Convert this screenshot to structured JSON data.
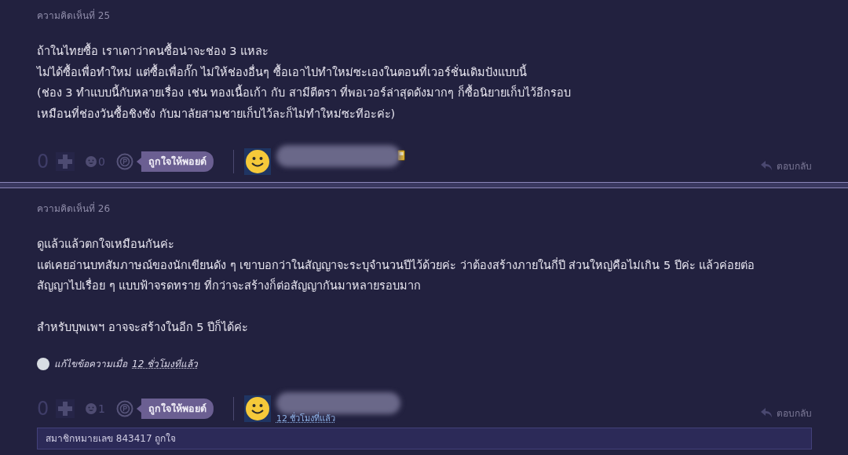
{
  "comments": [
    {
      "header": "ความคิดเห็นที่ 25",
      "body": [
        "ถ้าในไทยซื้อ เราเดาว่าคนซื้อน่าจะช่อง 3 แหละ",
        "ไม่ได้ซื้อเพื่อทำใหม่ แต่ซื้อเพื่อกั๊ก ไม่ให้ช่องอื่นๆ ซื้อเอาไปทำใหม่ซะเองในตอนที่เวอร์ชั่นเดิมปังแบบนี้",
        "(ช่อง 3 ทำแบบนี้กับหลายเรื่อง เช่น ทองเนื้อเก้า กับ สามีตีตรา ที่พอเวอร์ล่าสุดดังมากๆ ก็ซื้อนิยายเก็บไว้อีกรอบ",
        "เหมือนที่ช่องวันซื้อชิงชัง กับมาลัยสามชายเก็บไว้ละก็ไม่ทำใหม่ซะทีอะค่ะ)"
      ],
      "votes": "0",
      "emoji_count": "0",
      "point_button": "ถูกใจให้พอยด์",
      "badge": true,
      "reply": "ตอบกลับ"
    },
    {
      "header": "ความคิดเห็นที่ 26",
      "body": [
        "ดูแล้วแล้วตกใจเหมือนกันค่ะ",
        "แต่เคยอ่านบทสัมภาษณ์ของนักเขียนดัง ๆ เขาบอกว่าในสัญญาจะระบุจำนวนปีไว้ด้วยค่ะ  ว่าต้องสร้างภายในกี่ปี ส่วนใหญ่คือไม่เกิน 5 ปีค่ะ แล้วค่อยต่อ",
        "สัญญาไปเรื่อย ๆ แบบฟ้าจรดทราย ที่กว่าจะสร้างก็ต่อสัญญากันมาหลายรอบมาก",
        "สำหรับบุพเพฯ อาจจะสร้างในอีก 5 ปีก็ได้ค่ะ"
      ],
      "edited": {
        "prefix": "แก้ไขข้อความเมื่อ",
        "time": "12 ชั่วโมงที่แล้ว"
      },
      "votes": "0",
      "emoji_count": "1",
      "point_button": "ถูกใจให้พอยด์",
      "time": "12 ชั่วโมงที่แล้ว",
      "badge": false,
      "reply": "ตอบกลับ",
      "likes_note": "สมาชิกหมายเลข 843417 ถูกใจ"
    }
  ]
}
